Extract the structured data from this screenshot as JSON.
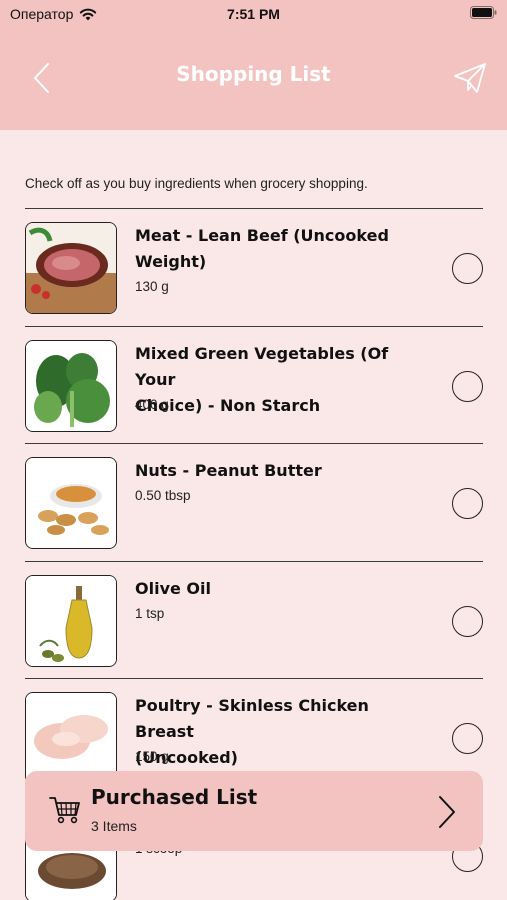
{
  "status_bar": {
    "carrier": "Оператор",
    "time": "7:51 PM"
  },
  "nav": {
    "title": "Shopping List"
  },
  "intro_text": "Check off as you buy ingredients when grocery shopping.",
  "items": [
    {
      "name_lines": [
        "Meat - Lean Beef (Uncooked",
        "Weight)"
      ],
      "qty": "130 g",
      "image": "beef-image",
      "checked": false
    },
    {
      "name_lines": [
        "Mixed Green Vegetables (Of Your",
        "Choice) - Non Starch"
      ],
      "qty": "400 g",
      "image": "vegetables-image",
      "checked": false
    },
    {
      "name_lines": [
        "Nuts - Peanut Butter"
      ],
      "qty": "0.50 tbsp",
      "image": "peanut-butter-image",
      "checked": false
    },
    {
      "name_lines": [
        "Olive Oil"
      ],
      "qty": "1 tsp",
      "image": "olive-oil-image",
      "checked": false
    },
    {
      "name_lines": [
        "Poultry - Skinless Chicken Breast",
        "(Uncooked)"
      ],
      "qty": "150 g",
      "image": "chicken-breast-image",
      "checked": false
    },
    {
      "name_lines": [],
      "qty": "1 scoop",
      "image": "protein-powder-image",
      "checked": false
    }
  ],
  "purchased": {
    "title": "Purchased List",
    "count": "3 Items"
  },
  "colors": {
    "header": "#f2c3c0",
    "background": "#f9e8e7",
    "card": "#f2c3c0"
  }
}
